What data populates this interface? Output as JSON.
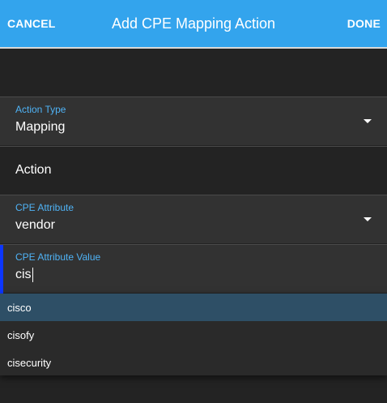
{
  "header": {
    "cancel_label": "CANCEL",
    "title": "Add CPE Mapping Action",
    "done_label": "DONE"
  },
  "form": {
    "action_type": {
      "label": "Action Type",
      "value": "Mapping"
    },
    "action": {
      "label": "Action"
    },
    "cpe_attribute": {
      "label": "CPE Attribute",
      "value": "vendor"
    },
    "cpe_attribute_value": {
      "label": "CPE Attribute Value",
      "value": "cis"
    }
  },
  "suggestions": [
    {
      "label": "cisco",
      "highlighted": true
    },
    {
      "label": "cisofy",
      "highlighted": false
    },
    {
      "label": "cisecurity",
      "highlighted": false
    }
  ],
  "colors": {
    "header_bg": "#33a4ed",
    "label_accent": "#4fb3f6",
    "focus_bar": "#0c36ff",
    "highlight_bg": "#2e4f66"
  },
  "icons": {
    "dropdown_caret": "chevron-down-icon"
  }
}
